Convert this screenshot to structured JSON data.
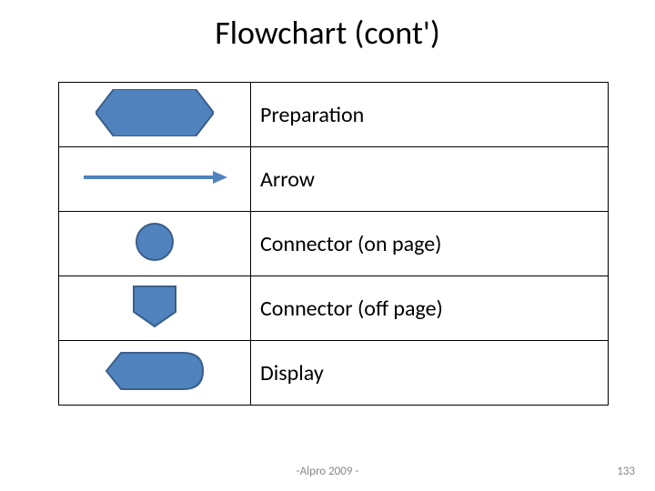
{
  "title": "Flowchart (cont')",
  "rows": [
    {
      "label": "Preparation"
    },
    {
      "label": "Arrow"
    },
    {
      "label": "Connector (on page)"
    },
    {
      "label": "Connector (off page)"
    },
    {
      "label": "Display"
    }
  ],
  "shape_fill": "#5082BE",
  "shape_stroke": "#3A5F8A",
  "footer_center": "-Alpro 2009 -",
  "footer_right": "133"
}
